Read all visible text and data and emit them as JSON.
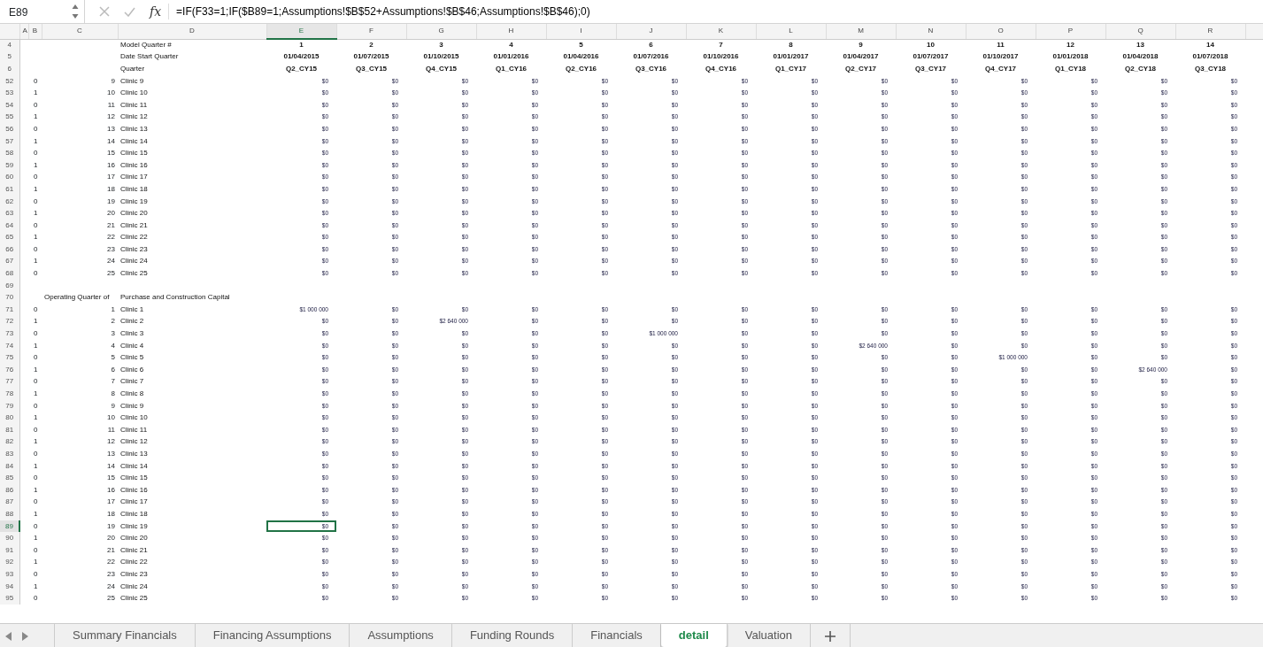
{
  "formula_bar": {
    "name_box": "E89",
    "fx": "fx",
    "formula": "=IF(F33=1;IF($B89=1;Assumptions!$B$52+Assumptions!$B$46;Assumptions!$B$46);0)"
  },
  "columns": [
    {
      "label": "A",
      "selected": false
    },
    {
      "label": "B",
      "selected": false
    },
    {
      "label": "C",
      "selected": false
    },
    {
      "label": "D",
      "selected": false
    },
    {
      "label": "E",
      "selected": true
    },
    {
      "label": "F",
      "selected": false
    },
    {
      "label": "G",
      "selected": false
    },
    {
      "label": "H",
      "selected": false
    },
    {
      "label": "I",
      "selected": false
    },
    {
      "label": "J",
      "selected": false
    },
    {
      "label": "K",
      "selected": false
    },
    {
      "label": "L",
      "selected": false
    },
    {
      "label": "M",
      "selected": false
    },
    {
      "label": "N",
      "selected": false
    },
    {
      "label": "O",
      "selected": false
    },
    {
      "label": "P",
      "selected": false
    },
    {
      "label": "Q",
      "selected": false
    },
    {
      "label": "R",
      "selected": false
    }
  ],
  "header_rows": [
    {
      "row": "4",
      "label": "Model Quarter #",
      "values": [
        "1",
        "2",
        "3",
        "4",
        "5",
        "6",
        "7",
        "8",
        "9",
        "10",
        "11",
        "12",
        "13",
        "14"
      ]
    },
    {
      "row": "5",
      "label": "Date Start Quarter",
      "values": [
        "01/04/2015",
        "01/07/2015",
        "01/10/2015",
        "01/01/2016",
        "01/04/2016",
        "01/07/2016",
        "01/10/2016",
        "01/01/2017",
        "01/04/2017",
        "01/07/2017",
        "01/10/2017",
        "01/01/2018",
        "01/04/2018",
        "01/07/2018"
      ]
    },
    {
      "row": "6",
      "label": "Quarter",
      "values": [
        "Q2_CY15",
        "Q3_CY15",
        "Q4_CY15",
        "Q1_CY16",
        "Q2_CY16",
        "Q3_CY16",
        "Q4_CY16",
        "Q1_CY17",
        "Q2_CY17",
        "Q3_CY17",
        "Q4_CY17",
        "Q1_CY18",
        "Q2_CY18",
        "Q3_CY18"
      ]
    }
  ],
  "rows": [
    {
      "row": "52",
      "selected": false,
      "b": "0",
      "c": "9",
      "d": "Clinic 9",
      "values": [
        "$0",
        "$0",
        "$0",
        "$0",
        "$0",
        "$0",
        "$0",
        "$0",
        "$0",
        "$0",
        "$0",
        "$0",
        "$0",
        "$0"
      ]
    },
    {
      "row": "53",
      "selected": false,
      "b": "1",
      "c": "10",
      "d": "Clinic 10",
      "values": [
        "$0",
        "$0",
        "$0",
        "$0",
        "$0",
        "$0",
        "$0",
        "$0",
        "$0",
        "$0",
        "$0",
        "$0",
        "$0",
        "$0"
      ]
    },
    {
      "row": "54",
      "selected": false,
      "b": "0",
      "c": "11",
      "d": "Clinic 11",
      "values": [
        "$0",
        "$0",
        "$0",
        "$0",
        "$0",
        "$0",
        "$0",
        "$0",
        "$0",
        "$0",
        "$0",
        "$0",
        "$0",
        "$0"
      ]
    },
    {
      "row": "55",
      "selected": false,
      "b": "1",
      "c": "12",
      "d": "Clinic 12",
      "values": [
        "$0",
        "$0",
        "$0",
        "$0",
        "$0",
        "$0",
        "$0",
        "$0",
        "$0",
        "$0",
        "$0",
        "$0",
        "$0",
        "$0"
      ]
    },
    {
      "row": "56",
      "selected": false,
      "b": "0",
      "c": "13",
      "d": "Clinic 13",
      "values": [
        "$0",
        "$0",
        "$0",
        "$0",
        "$0",
        "$0",
        "$0",
        "$0",
        "$0",
        "$0",
        "$0",
        "$0",
        "$0",
        "$0"
      ]
    },
    {
      "row": "57",
      "selected": false,
      "b": "1",
      "c": "14",
      "d": "Clinic 14",
      "values": [
        "$0",
        "$0",
        "$0",
        "$0",
        "$0",
        "$0",
        "$0",
        "$0",
        "$0",
        "$0",
        "$0",
        "$0",
        "$0",
        "$0"
      ]
    },
    {
      "row": "58",
      "selected": false,
      "b": "0",
      "c": "15",
      "d": "Clinic 15",
      "values": [
        "$0",
        "$0",
        "$0",
        "$0",
        "$0",
        "$0",
        "$0",
        "$0",
        "$0",
        "$0",
        "$0",
        "$0",
        "$0",
        "$0"
      ]
    },
    {
      "row": "59",
      "selected": false,
      "b": "1",
      "c": "16",
      "d": "Clinic 16",
      "values": [
        "$0",
        "$0",
        "$0",
        "$0",
        "$0",
        "$0",
        "$0",
        "$0",
        "$0",
        "$0",
        "$0",
        "$0",
        "$0",
        "$0"
      ]
    },
    {
      "row": "60",
      "selected": false,
      "b": "0",
      "c": "17",
      "d": "Clinic 17",
      "values": [
        "$0",
        "$0",
        "$0",
        "$0",
        "$0",
        "$0",
        "$0",
        "$0",
        "$0",
        "$0",
        "$0",
        "$0",
        "$0",
        "$0"
      ]
    },
    {
      "row": "61",
      "selected": false,
      "b": "1",
      "c": "18",
      "d": "Clinic 18",
      "values": [
        "$0",
        "$0",
        "$0",
        "$0",
        "$0",
        "$0",
        "$0",
        "$0",
        "$0",
        "$0",
        "$0",
        "$0",
        "$0",
        "$0"
      ]
    },
    {
      "row": "62",
      "selected": false,
      "b": "0",
      "c": "19",
      "d": "Clinic 19",
      "values": [
        "$0",
        "$0",
        "$0",
        "$0",
        "$0",
        "$0",
        "$0",
        "$0",
        "$0",
        "$0",
        "$0",
        "$0",
        "$0",
        "$0"
      ]
    },
    {
      "row": "63",
      "selected": false,
      "b": "1",
      "c": "20",
      "d": "Clinic 20",
      "values": [
        "$0",
        "$0",
        "$0",
        "$0",
        "$0",
        "$0",
        "$0",
        "$0",
        "$0",
        "$0",
        "$0",
        "$0",
        "$0",
        "$0"
      ]
    },
    {
      "row": "64",
      "selected": false,
      "b": "0",
      "c": "21",
      "d": "Clinic 21",
      "values": [
        "$0",
        "$0",
        "$0",
        "$0",
        "$0",
        "$0",
        "$0",
        "$0",
        "$0",
        "$0",
        "$0",
        "$0",
        "$0",
        "$0"
      ]
    },
    {
      "row": "65",
      "selected": false,
      "b": "1",
      "c": "22",
      "d": "Clinic 22",
      "values": [
        "$0",
        "$0",
        "$0",
        "$0",
        "$0",
        "$0",
        "$0",
        "$0",
        "$0",
        "$0",
        "$0",
        "$0",
        "$0",
        "$0"
      ]
    },
    {
      "row": "66",
      "selected": false,
      "b": "0",
      "c": "23",
      "d": "Clinic 23",
      "values": [
        "$0",
        "$0",
        "$0",
        "$0",
        "$0",
        "$0",
        "$0",
        "$0",
        "$0",
        "$0",
        "$0",
        "$0",
        "$0",
        "$0"
      ]
    },
    {
      "row": "67",
      "selected": false,
      "b": "1",
      "c": "24",
      "d": "Clinic 24",
      "values": [
        "$0",
        "$0",
        "$0",
        "$0",
        "$0",
        "$0",
        "$0",
        "$0",
        "$0",
        "$0",
        "$0",
        "$0",
        "$0",
        "$0"
      ]
    },
    {
      "row": "68",
      "selected": false,
      "b": "0",
      "c": "25",
      "d": "Clinic 25",
      "values": [
        "$0",
        "$0",
        "$0",
        "$0",
        "$0",
        "$0",
        "$0",
        "$0",
        "$0",
        "$0",
        "$0",
        "$0",
        "$0",
        "$0"
      ]
    },
    {
      "row": "69",
      "selected": false
    },
    {
      "row": "70",
      "selected": false,
      "c": "Operating Quarter of",
      "d": "Purchase and Construction Capital"
    },
    {
      "row": "71",
      "selected": false,
      "b": "0",
      "c": "1",
      "d": "Clinic 1",
      "values": [
        "$1 000 000",
        "$0",
        "$0",
        "$0",
        "$0",
        "$0",
        "$0",
        "$0",
        "$0",
        "$0",
        "$0",
        "$0",
        "$0",
        "$0"
      ]
    },
    {
      "row": "72",
      "selected": false,
      "b": "1",
      "c": "2",
      "d": "Clinic 2",
      "values": [
        "$0",
        "$0",
        "$2 640 000",
        "$0",
        "$0",
        "$0",
        "$0",
        "$0",
        "$0",
        "$0",
        "$0",
        "$0",
        "$0",
        "$0"
      ]
    },
    {
      "row": "73",
      "selected": false,
      "b": "0",
      "c": "3",
      "d": "Clinic 3",
      "values": [
        "$0",
        "$0",
        "$0",
        "$0",
        "$0",
        "$1 000 000",
        "$0",
        "$0",
        "$0",
        "$0",
        "$0",
        "$0",
        "$0",
        "$0"
      ]
    },
    {
      "row": "74",
      "selected": false,
      "b": "1",
      "c": "4",
      "d": "Clinic 4",
      "values": [
        "$0",
        "$0",
        "$0",
        "$0",
        "$0",
        "$0",
        "$0",
        "$0",
        "$2 640 000",
        "$0",
        "$0",
        "$0",
        "$0",
        "$0"
      ]
    },
    {
      "row": "75",
      "selected": false,
      "b": "0",
      "c": "5",
      "d": "Clinic 5",
      "values": [
        "$0",
        "$0",
        "$0",
        "$0",
        "$0",
        "$0",
        "$0",
        "$0",
        "$0",
        "$0",
        "$1 000 000",
        "$0",
        "$0",
        "$0"
      ]
    },
    {
      "row": "76",
      "selected": false,
      "b": "1",
      "c": "6",
      "d": "Clinic 6",
      "values": [
        "$0",
        "$0",
        "$0",
        "$0",
        "$0",
        "$0",
        "$0",
        "$0",
        "$0",
        "$0",
        "$0",
        "$0",
        "$2 640 000",
        "$0"
      ]
    },
    {
      "row": "77",
      "selected": false,
      "b": "0",
      "c": "7",
      "d": "Clinic 7",
      "values": [
        "$0",
        "$0",
        "$0",
        "$0",
        "$0",
        "$0",
        "$0",
        "$0",
        "$0",
        "$0",
        "$0",
        "$0",
        "$0",
        "$0"
      ]
    },
    {
      "row": "78",
      "selected": false,
      "b": "1",
      "c": "8",
      "d": "Clinic 8",
      "values": [
        "$0",
        "$0",
        "$0",
        "$0",
        "$0",
        "$0",
        "$0",
        "$0",
        "$0",
        "$0",
        "$0",
        "$0",
        "$0",
        "$0"
      ]
    },
    {
      "row": "79",
      "selected": false,
      "b": "0",
      "c": "9",
      "d": "Clinic 9",
      "values": [
        "$0",
        "$0",
        "$0",
        "$0",
        "$0",
        "$0",
        "$0",
        "$0",
        "$0",
        "$0",
        "$0",
        "$0",
        "$0",
        "$0"
      ]
    },
    {
      "row": "80",
      "selected": false,
      "b": "1",
      "c": "10",
      "d": "Clinic 10",
      "values": [
        "$0",
        "$0",
        "$0",
        "$0",
        "$0",
        "$0",
        "$0",
        "$0",
        "$0",
        "$0",
        "$0",
        "$0",
        "$0",
        "$0"
      ]
    },
    {
      "row": "81",
      "selected": false,
      "b": "0",
      "c": "11",
      "d": "Clinic 11",
      "values": [
        "$0",
        "$0",
        "$0",
        "$0",
        "$0",
        "$0",
        "$0",
        "$0",
        "$0",
        "$0",
        "$0",
        "$0",
        "$0",
        "$0"
      ]
    },
    {
      "row": "82",
      "selected": false,
      "b": "1",
      "c": "12",
      "d": "Clinic 12",
      "values": [
        "$0",
        "$0",
        "$0",
        "$0",
        "$0",
        "$0",
        "$0",
        "$0",
        "$0",
        "$0",
        "$0",
        "$0",
        "$0",
        "$0"
      ]
    },
    {
      "row": "83",
      "selected": false,
      "b": "0",
      "c": "13",
      "d": "Clinic 13",
      "values": [
        "$0",
        "$0",
        "$0",
        "$0",
        "$0",
        "$0",
        "$0",
        "$0",
        "$0",
        "$0",
        "$0",
        "$0",
        "$0",
        "$0"
      ]
    },
    {
      "row": "84",
      "selected": false,
      "b": "1",
      "c": "14",
      "d": "Clinic 14",
      "values": [
        "$0",
        "$0",
        "$0",
        "$0",
        "$0",
        "$0",
        "$0",
        "$0",
        "$0",
        "$0",
        "$0",
        "$0",
        "$0",
        "$0"
      ]
    },
    {
      "row": "85",
      "selected": false,
      "b": "0",
      "c": "15",
      "d": "Clinic 15",
      "values": [
        "$0",
        "$0",
        "$0",
        "$0",
        "$0",
        "$0",
        "$0",
        "$0",
        "$0",
        "$0",
        "$0",
        "$0",
        "$0",
        "$0"
      ]
    },
    {
      "row": "86",
      "selected": false,
      "b": "1",
      "c": "16",
      "d": "Clinic 16",
      "values": [
        "$0",
        "$0",
        "$0",
        "$0",
        "$0",
        "$0",
        "$0",
        "$0",
        "$0",
        "$0",
        "$0",
        "$0",
        "$0",
        "$0"
      ]
    },
    {
      "row": "87",
      "selected": false,
      "b": "0",
      "c": "17",
      "d": "Clinic 17",
      "values": [
        "$0",
        "$0",
        "$0",
        "$0",
        "$0",
        "$0",
        "$0",
        "$0",
        "$0",
        "$0",
        "$0",
        "$0",
        "$0",
        "$0"
      ]
    },
    {
      "row": "88",
      "selected": false,
      "b": "1",
      "c": "18",
      "d": "Clinic 18",
      "values": [
        "$0",
        "$0",
        "$0",
        "$0",
        "$0",
        "$0",
        "$0",
        "$0",
        "$0",
        "$0",
        "$0",
        "$0",
        "$0",
        "$0"
      ]
    },
    {
      "row": "89",
      "selected": true,
      "b": "0",
      "c": "19",
      "d": "Clinic 19",
      "values": [
        "$0",
        "$0",
        "$0",
        "$0",
        "$0",
        "$0",
        "$0",
        "$0",
        "$0",
        "$0",
        "$0",
        "$0",
        "$0",
        "$0"
      ]
    },
    {
      "row": "90",
      "selected": false,
      "b": "1",
      "c": "20",
      "d": "Clinic 20",
      "values": [
        "$0",
        "$0",
        "$0",
        "$0",
        "$0",
        "$0",
        "$0",
        "$0",
        "$0",
        "$0",
        "$0",
        "$0",
        "$0",
        "$0"
      ]
    },
    {
      "row": "91",
      "selected": false,
      "b": "0",
      "c": "21",
      "d": "Clinic 21",
      "values": [
        "$0",
        "$0",
        "$0",
        "$0",
        "$0",
        "$0",
        "$0",
        "$0",
        "$0",
        "$0",
        "$0",
        "$0",
        "$0",
        "$0"
      ]
    },
    {
      "row": "92",
      "selected": false,
      "b": "1",
      "c": "22",
      "d": "Clinic 22",
      "values": [
        "$0",
        "$0",
        "$0",
        "$0",
        "$0",
        "$0",
        "$0",
        "$0",
        "$0",
        "$0",
        "$0",
        "$0",
        "$0",
        "$0"
      ]
    },
    {
      "row": "93",
      "selected": false,
      "b": "0",
      "c": "23",
      "d": "Clinic 23",
      "values": [
        "$0",
        "$0",
        "$0",
        "$0",
        "$0",
        "$0",
        "$0",
        "$0",
        "$0",
        "$0",
        "$0",
        "$0",
        "$0",
        "$0"
      ]
    },
    {
      "row": "94",
      "selected": false,
      "b": "1",
      "c": "24",
      "d": "Clinic 24",
      "values": [
        "$0",
        "$0",
        "$0",
        "$0",
        "$0",
        "$0",
        "$0",
        "$0",
        "$0",
        "$0",
        "$0",
        "$0",
        "$0",
        "$0"
      ]
    },
    {
      "row": "95",
      "selected": false,
      "b": "0",
      "c": "25",
      "d": "Clinic 25",
      "values": [
        "$0",
        "$0",
        "$0",
        "$0",
        "$0",
        "$0",
        "$0",
        "$0",
        "$0",
        "$0",
        "$0",
        "$0",
        "$0",
        "$0"
      ]
    }
  ],
  "sheet_tabs": [
    {
      "label": "Summary Financials",
      "selected": false
    },
    {
      "label": "Financing Assumptions",
      "selected": false
    },
    {
      "label": "Assumptions",
      "selected": false
    },
    {
      "label": "Funding Rounds",
      "selected": false
    },
    {
      "label": "Financials",
      "selected": false
    },
    {
      "label": "detail",
      "selected": true
    },
    {
      "label": "Valuation",
      "selected": false
    }
  ]
}
